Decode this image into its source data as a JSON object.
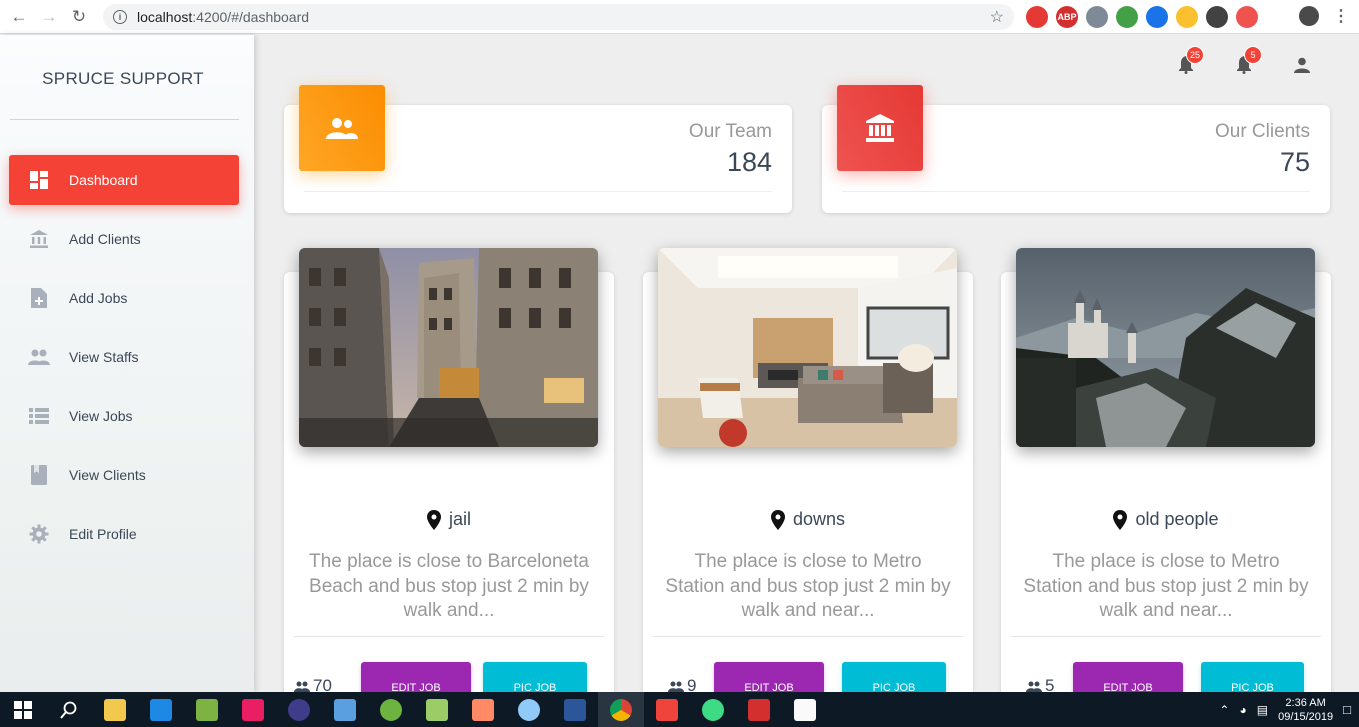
{
  "browser": {
    "url_host": "localhost",
    "url_path": ":4200/#/dashboard",
    "extensions": [
      {
        "name": "block-icon",
        "color": "#e53935",
        "label": ""
      },
      {
        "name": "adblock-icon",
        "color": "#d32f2f",
        "label": "ABP"
      },
      {
        "name": "vue-icon",
        "color": "#7e8a97",
        "label": ""
      },
      {
        "name": "node-icon",
        "color": "#43a047",
        "label": ""
      },
      {
        "name": "eyedropper-icon",
        "color": "#1a73e8",
        "label": ""
      },
      {
        "name": "moon-icon",
        "color": "#fbc02d",
        "label": ""
      },
      {
        "name": "key-icon",
        "color": "#424242",
        "label": ""
      },
      {
        "name": "cast-icon",
        "color": "#ef5350",
        "label": ""
      }
    ]
  },
  "sidebar": {
    "brand": "SPRUCE SUPPORT",
    "items": [
      {
        "label": "Dashboard",
        "icon": "dashboard-icon",
        "active": true
      },
      {
        "label": "Add Clients",
        "icon": "bank-icon",
        "active": false
      },
      {
        "label": "Add Jobs",
        "icon": "note-add-icon",
        "active": false
      },
      {
        "label": "View Staffs",
        "icon": "people-icon",
        "active": false
      },
      {
        "label": "View Jobs",
        "icon": "list-icon",
        "active": false
      },
      {
        "label": "View Clients",
        "icon": "book-icon",
        "active": false
      },
      {
        "label": "Edit Profile",
        "icon": "gear-icon",
        "active": false
      }
    ]
  },
  "topbar": {
    "notifications_1": "25",
    "notifications_2": "5"
  },
  "stats": {
    "team": {
      "title": "Our Team",
      "value": "184",
      "color": "#fb8c00"
    },
    "clients": {
      "title": "Our Clients",
      "value": "75",
      "color": "#e53935"
    }
  },
  "listings": [
    {
      "location": "jail",
      "description": "The place is close to Barceloneta Beach and bus stop just 2 min by walk and...",
      "people": "70",
      "edit_label": "EDIT JOB",
      "pic_label": "PIC JOB",
      "image": "city-street-photo"
    },
    {
      "location": "downs",
      "description": "The place is close to Metro Station and bus stop just 2 min by walk and near...",
      "people": "9",
      "edit_label": "EDIT JOB",
      "pic_label": "PIC JOB",
      "image": "living-room-photo"
    },
    {
      "location": "old people",
      "description": "The place is close to Metro Station and bus stop just 2 min by walk and near...",
      "people": "5",
      "edit_label": "EDIT JOB",
      "pic_label": "PIC JOB",
      "image": "castle-mountain-photo"
    }
  ],
  "taskbar": {
    "time": "2:36 AM",
    "date": "09/15/2019"
  }
}
